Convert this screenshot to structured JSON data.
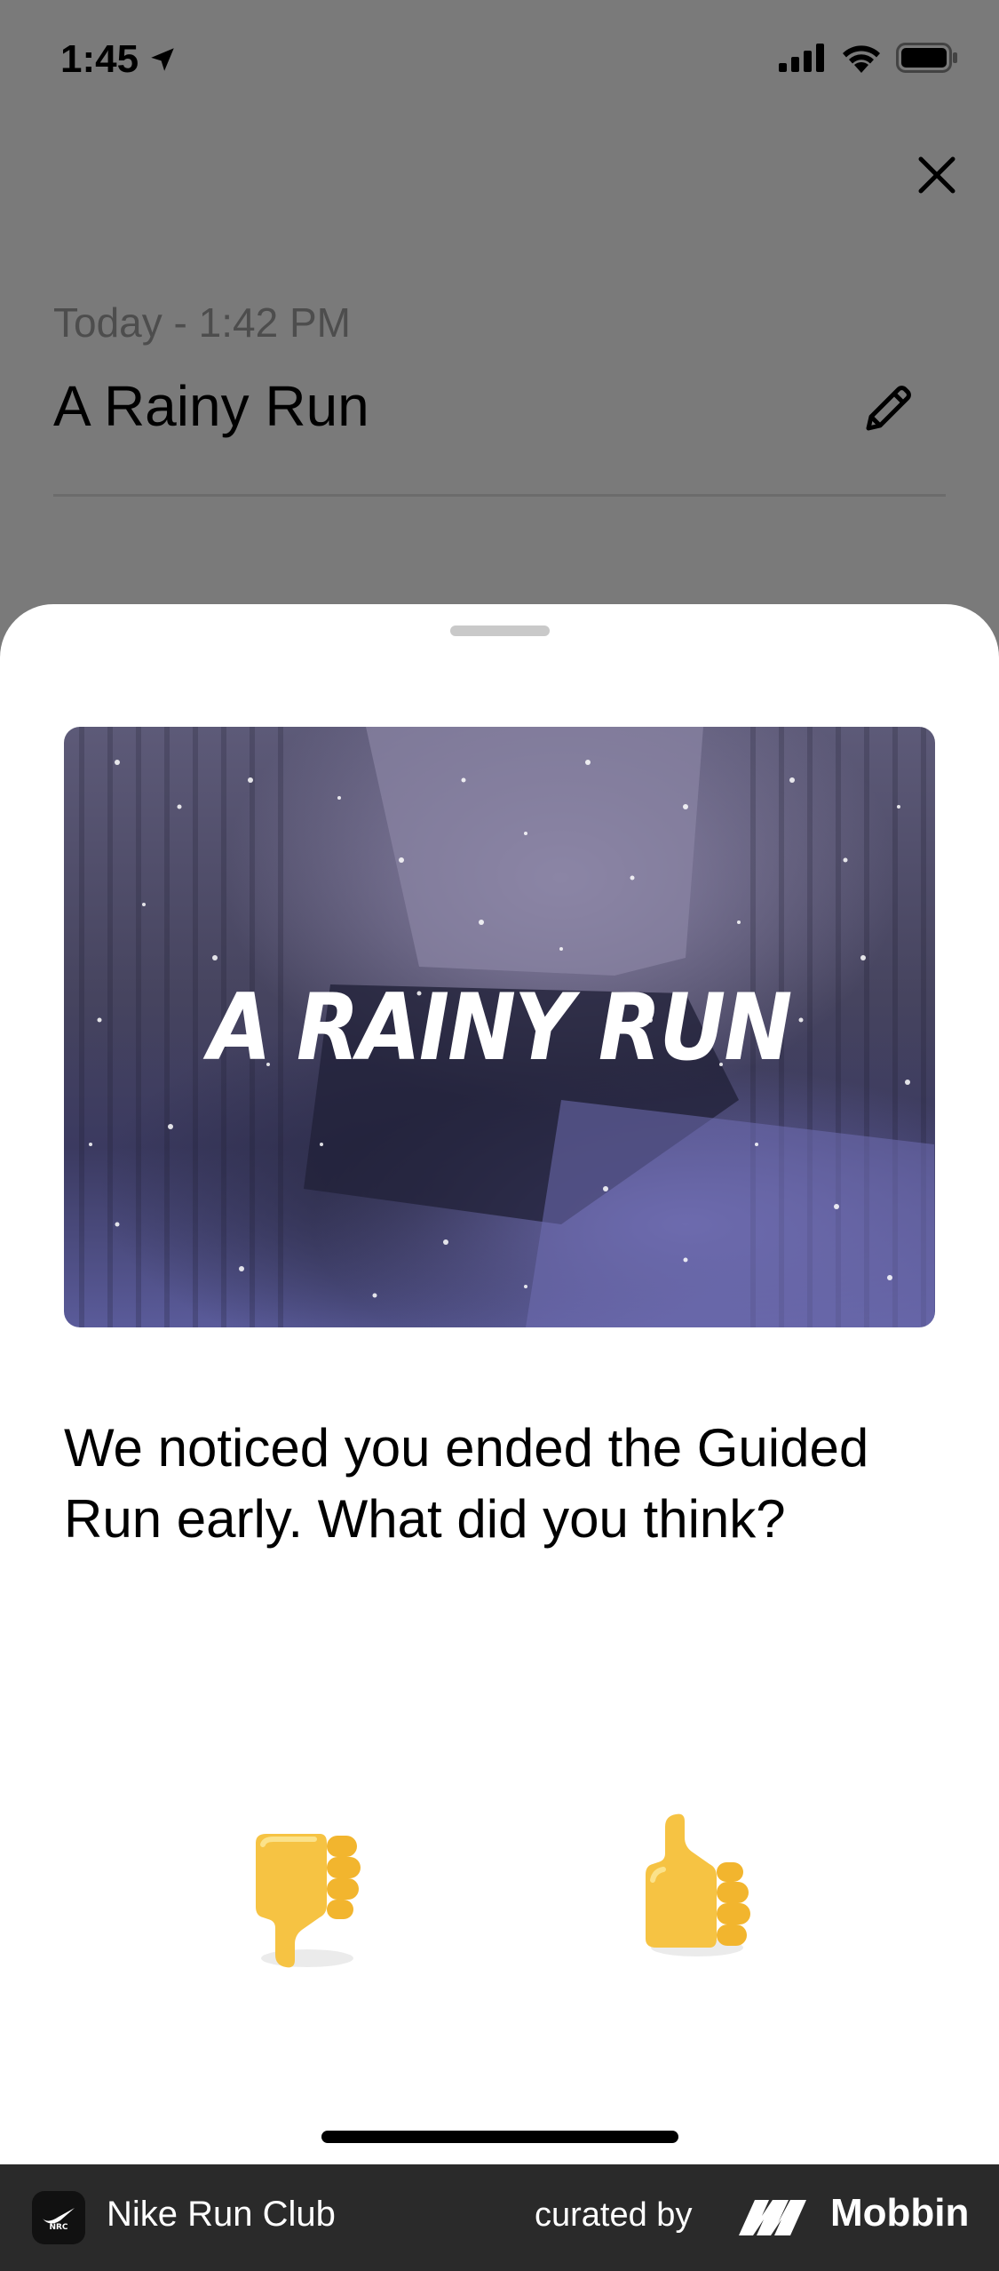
{
  "status_bar": {
    "time": "1:45",
    "location_icon": "location-arrow-icon",
    "signal_icon": "cellular-signal-icon",
    "wifi_icon": "wifi-icon",
    "battery_icon": "battery-icon"
  },
  "background": {
    "date_label": "Today - 1:42 PM",
    "run_title": "A Rainy Run",
    "close_icon": "close-icon",
    "edit_icon": "pencil-icon"
  },
  "sheet": {
    "hero_title": "A RAINY RUN",
    "question": "We noticed you ended the Guided Run early. What did you think?",
    "reactions": [
      {
        "name": "thumbs-down",
        "emoji": "👎"
      },
      {
        "name": "thumbs-up",
        "emoji": "👍"
      }
    ]
  },
  "footer": {
    "app_name": "Nike Run Club",
    "curated_by": "curated by",
    "brand": "Mobbin"
  },
  "colors": {
    "dim_overlay": "#7a7a7a",
    "sheet": "#ffffff",
    "footer": "#2a2a2a",
    "hero_tint": "#5a5b9a",
    "emoji_yellow": "#f5c542"
  }
}
